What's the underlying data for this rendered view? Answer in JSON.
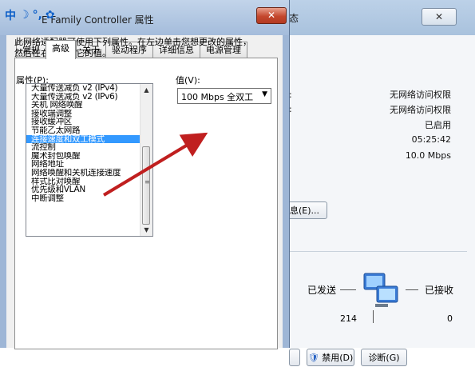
{
  "ime": {
    "chinese_mode": "中",
    "moon": "☽",
    "punct": "°,",
    "gear": "✿"
  },
  "background_window": {
    "title": "态",
    "close": "✕",
    "status": {
      "ipv4_connectivity": "无网络访问权限",
      "ipv6_connectivity": "无网络访问权限",
      "media_state": "已启用",
      "duration": "05:25:42",
      "speed": "10.0 Mbps"
    },
    "details_button": "息(E)...",
    "activity": {
      "sent_label": "已发送",
      "received_label": "已接收",
      "sent_value": "214",
      "received_value": "0"
    },
    "buttons": {
      "disable": "禁用(D)",
      "diagnose": "诊断(G)"
    }
  },
  "dialog": {
    "title": "E Family Controller 属性",
    "close": "✕",
    "tabs": [
      "常规",
      "高级",
      "关于",
      "驱动程序",
      "详细信息",
      "电源管理"
    ],
    "active_tab": 1,
    "description": "此网络适配器可使用下列属性。在左边单击您想更改的属性，然后在右边选择它的值。",
    "property_label": "属性(P):",
    "value_label": "值(V):",
    "properties": [
      "大量传送减负 v2 (IPv4)",
      "大量传送减负 v2 (IPv6)",
      "关机 网络唤醒",
      "接收端调整",
      "接收缓冲区",
      "节能乙太网路",
      "连接速度和双工模式",
      "流控制",
      "魔术封包唤醒",
      "网络地址",
      "网络唤醒和关机连接速度",
      "样式比对唤醒",
      "优先级和VLAN",
      "中断调整"
    ],
    "selected_property": 6,
    "value_selected": "100 Mbps 全双工"
  },
  "colors": {
    "arrow": "#c01f1f",
    "selection": "#3399ff",
    "ime_blue": "#0f60c8"
  }
}
